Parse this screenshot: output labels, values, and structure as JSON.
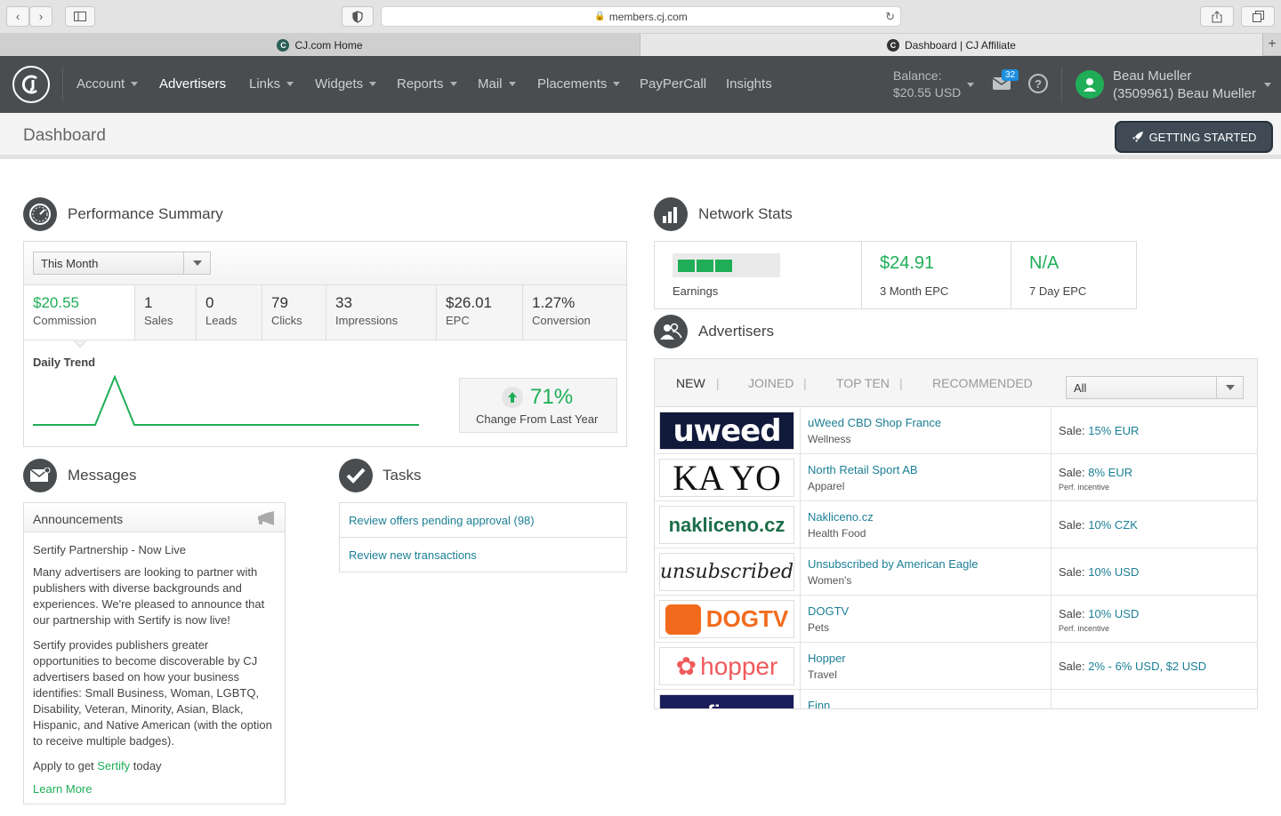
{
  "browser": {
    "url": "members.cj.com",
    "tabs": [
      {
        "label": "CJ.com Home"
      },
      {
        "label": "Dashboard | CJ Affiliate"
      }
    ]
  },
  "nav": {
    "items": [
      {
        "label": "Account"
      },
      {
        "label": "Advertisers"
      },
      {
        "label": "Links"
      },
      {
        "label": "Widgets"
      },
      {
        "label": "Reports"
      },
      {
        "label": "Mail"
      },
      {
        "label": "Placements"
      },
      {
        "label": "PayPerCall"
      },
      {
        "label": "Insights"
      }
    ],
    "balance_label": "Balance:",
    "balance_value": "$20.55 USD",
    "mail_count": "32",
    "help_glyph": "?",
    "user_name": "Beau Mueller",
    "user_id": "(3509961) Beau Mueller"
  },
  "page": {
    "title": "Dashboard",
    "getting_started": "GETTING STARTED"
  },
  "performance": {
    "title": "Performance Summary",
    "period": "This Month",
    "metrics": [
      {
        "value": "$20.55",
        "label": "Commission"
      },
      {
        "value": "1",
        "label": "Sales"
      },
      {
        "value": "0",
        "label": "Leads"
      },
      {
        "value": "79",
        "label": "Clicks"
      },
      {
        "value": "33",
        "label": "Impressions"
      },
      {
        "value": "$26.01",
        "label": "EPC"
      },
      {
        "value": "1.27%",
        "label": "Conversion"
      }
    ],
    "daily_trend_label": "Daily Trend",
    "change_pct": "71%",
    "change_label": "Change From Last Year"
  },
  "network": {
    "title": "Network Stats",
    "earnings_label": "Earnings",
    "earnings_level": 3,
    "earnings_max": 5,
    "epc3_value": "$24.91",
    "epc3_label": "3 Month EPC",
    "epc7_value": "N/A",
    "epc7_label": "7 Day EPC"
  },
  "advertisers": {
    "title": "Advertisers",
    "tabs": [
      {
        "label": "NEW"
      },
      {
        "label": "JOINED"
      },
      {
        "label": "TOP TEN"
      },
      {
        "label": "RECOMMENDED"
      }
    ],
    "tab_sep": "|",
    "filter": "All",
    "rows": [
      {
        "logo": "uweed",
        "name": "uWeed CBD Shop France",
        "category": "Wellness",
        "sale_label": "Sale:",
        "sale_value": "15% EUR",
        "perf": ""
      },
      {
        "logo": "KA YO",
        "name": "North Retail Sport AB",
        "category": "Apparel",
        "sale_label": "Sale:",
        "sale_value": "8% EUR",
        "perf": "Perf. incentive"
      },
      {
        "logo": "nakliceno.cz",
        "name": "Nakliceno.cz",
        "category": "Health Food",
        "sale_label": "Sale:",
        "sale_value": "10% CZK",
        "perf": ""
      },
      {
        "logo": "unsubscribed",
        "name": "Unsubscribed by American Eagle",
        "category": "Women's",
        "sale_label": "Sale:",
        "sale_value": "10% USD",
        "perf": ""
      },
      {
        "logo": "DOGTV",
        "name": "DOGTV",
        "category": "Pets",
        "sale_label": "Sale:",
        "sale_value": "10% USD",
        "perf": "Perf. incentive"
      },
      {
        "logo": "hopper",
        "name": "Hopper",
        "category": "Travel",
        "sale_label": "Sale:",
        "sale_value": "2% - 6% USD, $2 USD",
        "perf": ""
      },
      {
        "logo": "finn",
        "name": "Finn",
        "category": "",
        "sale_label": "",
        "sale_value": "",
        "perf": ""
      }
    ]
  },
  "messages": {
    "title": "Messages",
    "announcements_label": "Announcements",
    "headline": "Sertify Partnership - Now Live",
    "para1": "Many advertisers are looking to partner with publishers with diverse backgrounds and experiences. We're pleased to announce that our partnership with Sertify is now live!",
    "para2": "Sertify provides publishers greater opportunities to become discoverable by CJ advertisers based on how your business identifies: Small Business, Woman, LGBTQ, Disability, Veteran, Minority, Asian, Black, Hispanic, and Native American (with the option to receive multiple badges).",
    "apply_prefix": "Apply to get",
    "apply_link": "Sertify",
    "apply_suffix": "today",
    "learn_more": "Learn More"
  },
  "tasks": {
    "title": "Tasks",
    "items": [
      {
        "label": "Review offers pending approval (98)"
      },
      {
        "label": "Review new transactions"
      }
    ]
  },
  "colors": {
    "accent_green": "#1fae57",
    "link_teal": "#1b7f96",
    "nav_bg": "#4a4d4f"
  }
}
